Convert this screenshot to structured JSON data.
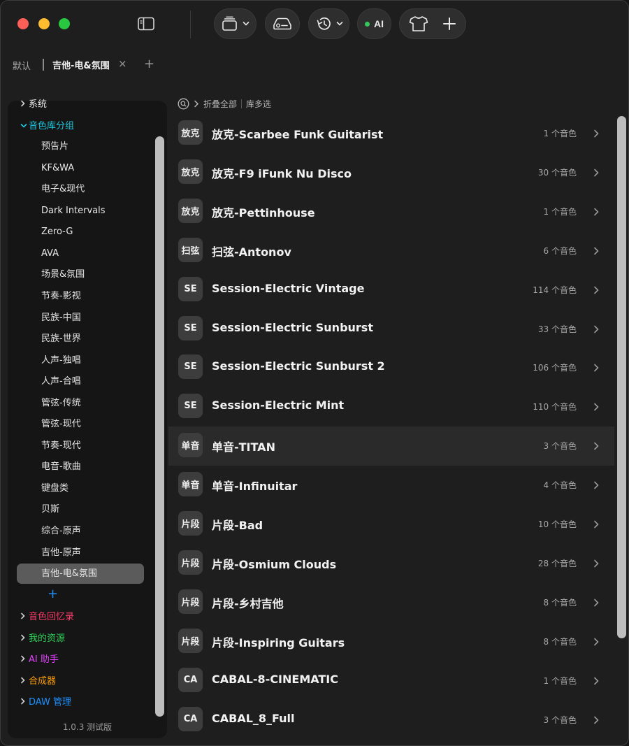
{
  "toolbar": {
    "ai_label": "AI"
  },
  "tabs": {
    "default_label": "默认",
    "active_label": "吉他-电&氛围",
    "close_glyph": "×",
    "add_glyph": "+"
  },
  "sidebar": {
    "top_sections": [
      {
        "label": "系统",
        "color": "#e6e6e6",
        "expanded": false
      },
      {
        "label": "音色库分组",
        "color": "#1ec8e0",
        "expanded": true
      },
      {
        "label": "音色回忆录",
        "color": "#ff3b6b",
        "expanded": false
      },
      {
        "label": "我的资源",
        "color": "#30d158",
        "expanded": false
      },
      {
        "label": "AI 助手",
        "color": "#e040fb",
        "expanded": false
      },
      {
        "label": "合成器",
        "color": "#ff9f0a",
        "expanded": false
      },
      {
        "label": "DAW 管理",
        "color": "#1e90ff",
        "expanded": false
      }
    ],
    "groups": [
      "预告片",
      "KF&WA",
      "电子&现代",
      "Dark Intervals",
      "Zero-G",
      "AVA",
      "场景&氛围",
      "节奏-影视",
      "民族-中国",
      "民族-世界",
      "人声-独唱",
      "人声-合唱",
      "管弦-传统",
      "管弦-现代",
      "节奏-现代",
      "电音-歌曲",
      "键盘类",
      "贝斯",
      "综合-原声",
      "吉他-原声",
      "吉他-电&氛围"
    ],
    "selected_group": "吉他-电&氛围",
    "add_glyph": "+",
    "version": "1.0.3 测试版"
  },
  "breadcrumb": {
    "collapse_all": "折叠全部",
    "multi_select": "库多选"
  },
  "libraries": [
    {
      "badge": "放克",
      "name": "放克-Scarbee Funk Guitarist",
      "count": "1 个音色"
    },
    {
      "badge": "放克",
      "name": "放克-F9 iFunk Nu Disco",
      "count": "30 个音色"
    },
    {
      "badge": "放克",
      "name": "放克-Pettinhouse",
      "count": "1 个音色"
    },
    {
      "badge": "扫弦",
      "name": "扫弦-Antonov",
      "count": "6 个音色"
    },
    {
      "badge": "SE",
      "name": "Session-Electric Vintage",
      "count": "114 个音色"
    },
    {
      "badge": "SE",
      "name": "Session-Electric Sunburst",
      "count": "33 个音色"
    },
    {
      "badge": "SE",
      "name": "Session-Electric Sunburst 2",
      "count": "106 个音色"
    },
    {
      "badge": "SE",
      "name": "Session-Electric Mint",
      "count": "110 个音色"
    },
    {
      "badge": "单音",
      "name": "单音-TITAN",
      "count": "3 个音色",
      "hover": true
    },
    {
      "badge": "单音",
      "name": "单音-Infinuitar",
      "count": "4 个音色"
    },
    {
      "badge": "片段",
      "name": "片段-Bad",
      "count": "10 个音色"
    },
    {
      "badge": "片段",
      "name": "片段-Osmium Clouds",
      "count": "28 个音色"
    },
    {
      "badge": "片段",
      "name": "片段-乡村吉他",
      "count": "8 个音色"
    },
    {
      "badge": "片段",
      "name": "片段-Inspiring Guitars",
      "count": "8 个音色"
    },
    {
      "badge": "CA",
      "name": "CABAL-8-CINEMATIC",
      "count": "1 个音色"
    },
    {
      "badge": "CA",
      "name": "CABAL_8_Full",
      "count": "3 个音色"
    }
  ]
}
